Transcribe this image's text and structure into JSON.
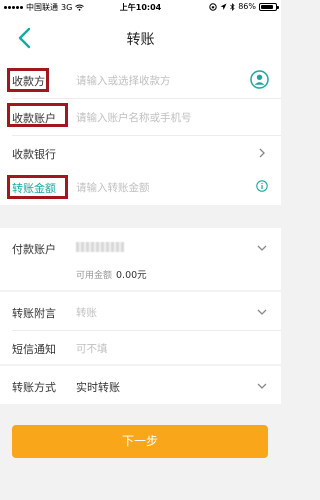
{
  "status_bar": {
    "carrier": "中国联通",
    "network": "3G",
    "time": "上午10:04",
    "battery": "86%",
    "battery_level": 0.86
  },
  "nav": {
    "title": "转账"
  },
  "form": {
    "payee": {
      "label": "收款方",
      "placeholder": "请输入或选择收款方"
    },
    "payee_account": {
      "label": "收款账户",
      "placeholder": "请输入账户名称或手机号"
    },
    "payee_bank": {
      "label": "收款银行"
    },
    "amount": {
      "label": "转账金额",
      "placeholder": "请输入转账金额"
    },
    "pay_account": {
      "label": "付款账户",
      "available_label": "可用金额",
      "available_value": "0.00元"
    },
    "memo": {
      "label": "转账附言",
      "placeholder": "转账"
    },
    "sms": {
      "label": "短信通知",
      "placeholder": "可不填"
    },
    "method": {
      "label": "转账方式",
      "value": "实时转账"
    }
  },
  "next_button": {
    "label": "下一步"
  },
  "colors": {
    "accent_teal": "#18a8a0",
    "button_orange": "#f9a61a",
    "highlight_red": "#a0181e"
  }
}
